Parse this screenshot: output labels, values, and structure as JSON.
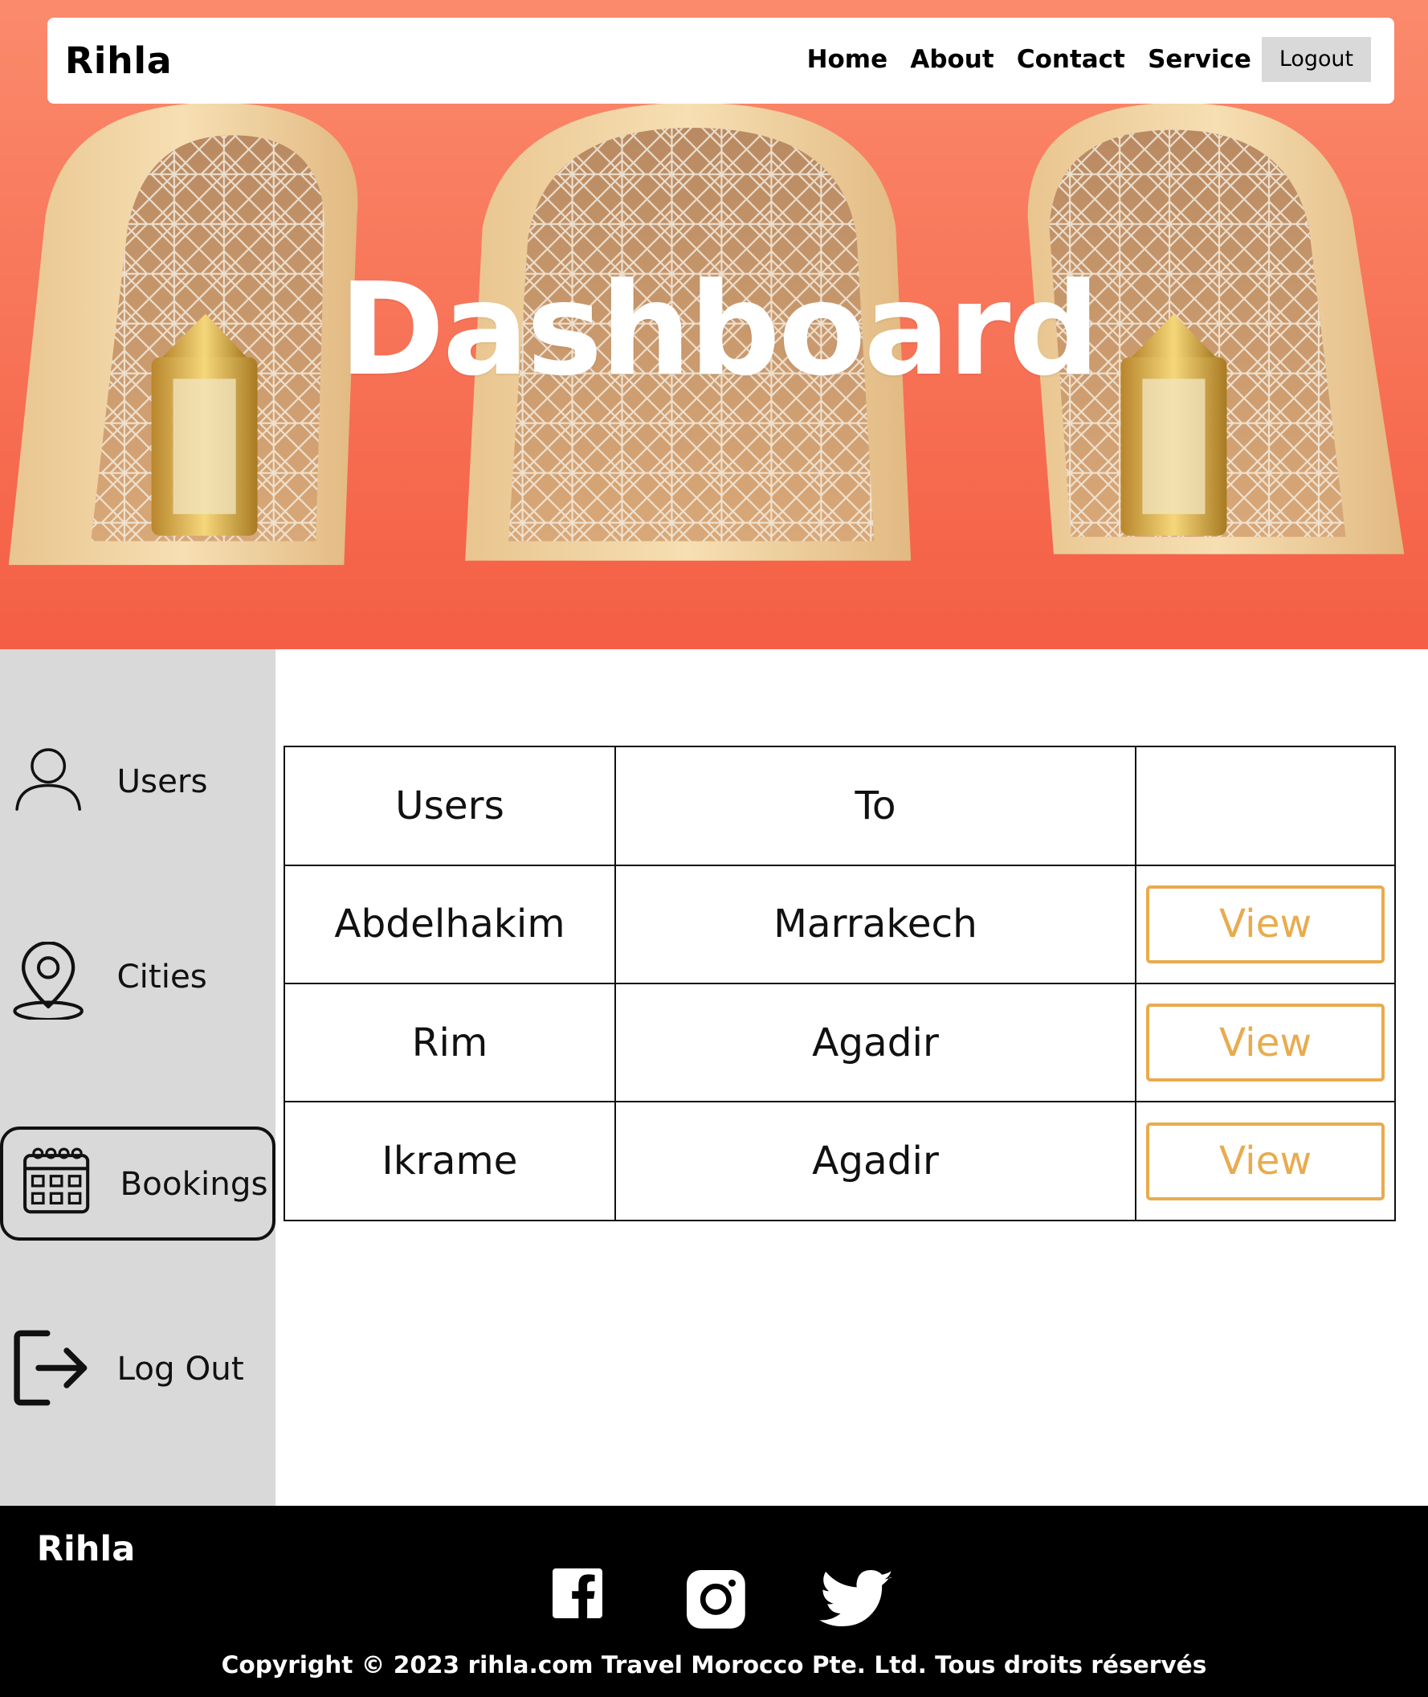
{
  "navbar": {
    "brand": "Rihla",
    "links": [
      "Home",
      "About",
      "Contact",
      "Service"
    ],
    "logout_label": "Logout"
  },
  "hero": {
    "title": "Dashboard"
  },
  "sidebar": {
    "items": [
      {
        "label": "Users",
        "icon": "user-icon",
        "active": false
      },
      {
        "label": "Cities",
        "icon": "map-pin-icon",
        "active": false
      },
      {
        "label": "Bookings",
        "icon": "calendar-icon",
        "active": true
      },
      {
        "label": "Log Out",
        "icon": "logout-icon",
        "active": false
      }
    ]
  },
  "table": {
    "headers": [
      "Users",
      "To",
      ""
    ],
    "rows": [
      {
        "user": "Abdelhakim",
        "to": "Marrakech",
        "action": "View"
      },
      {
        "user": "Rim",
        "to": "Agadir",
        "action": "View"
      },
      {
        "user": "Ikrame",
        "to": "Agadir",
        "action": "View"
      }
    ]
  },
  "footer": {
    "brand": "Rihla",
    "social": [
      "facebook-icon",
      "instagram-icon",
      "twitter-icon"
    ],
    "copyright": "Copyright © 2023 rihla.com Travel Morocco Pte. Ltd. Tous droits réservés"
  },
  "colors": {
    "hero_bg": "#f77458",
    "sidebar_bg": "#d9d9d9",
    "accent": "#e8ab4e",
    "footer_bg": "#000000",
    "logout_bg": "#d9d9d9"
  }
}
